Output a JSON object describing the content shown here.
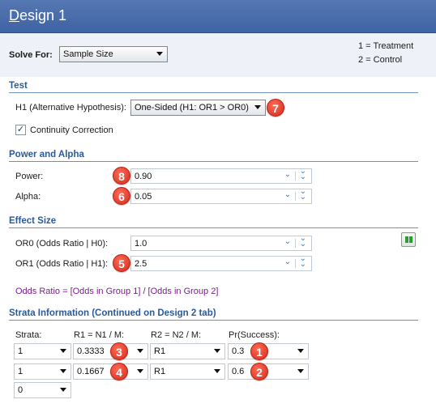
{
  "window": {
    "title": "Design 1"
  },
  "solve_for": {
    "label": "Solve For:",
    "value": "Sample Size"
  },
  "legend": {
    "line1": "1 = Treatment",
    "line2": "2 = Control"
  },
  "test": {
    "heading": "Test",
    "h1_label": "H1 (Alternative Hypothesis):",
    "h1_value": "One-Sided (H1: OR1 > OR0)",
    "continuity_label": "Continuity Correction",
    "continuity_checked": true
  },
  "power_alpha": {
    "heading": "Power and Alpha",
    "power_label": "Power:",
    "power_value": "0.90",
    "alpha_label": "Alpha:",
    "alpha_value": "0.05"
  },
  "effect_size": {
    "heading": "Effect Size",
    "or0_label": "OR0 (Odds Ratio | H0):",
    "or0_value": "1.0",
    "or1_label": "OR1 (Odds Ratio | H1):",
    "or1_value": "2.5",
    "note": "Odds Ratio = [Odds in Group 1] / [Odds in Group 2]"
  },
  "strata": {
    "heading": "Strata Information (Continued on Design 2 tab)",
    "columns": [
      "Strata:",
      "R1 = N1 / M:",
      "R2 = N2 / M:",
      "Pr(Success):"
    ],
    "rows": [
      {
        "strata": "1",
        "r1": "0.3333",
        "r2": "R1",
        "pr": "0.3"
      },
      {
        "strata": "1",
        "r1": "0.1667",
        "r2": "R1",
        "pr": "0.6"
      }
    ],
    "extra_strata": "0"
  },
  "badges": [
    "7",
    "8",
    "6",
    "5",
    "3",
    "1",
    "4",
    "2"
  ],
  "icons": {
    "combo_arrow": "chevron-down-icon",
    "double_chevron": "double-chevron-down-icon",
    "group_button": "pause-icon"
  },
  "colors": {
    "title_bar": "#4a6dad",
    "section_heading": "#2a5a9a",
    "badge": "#e0382a",
    "note": "#7a1f8a"
  }
}
